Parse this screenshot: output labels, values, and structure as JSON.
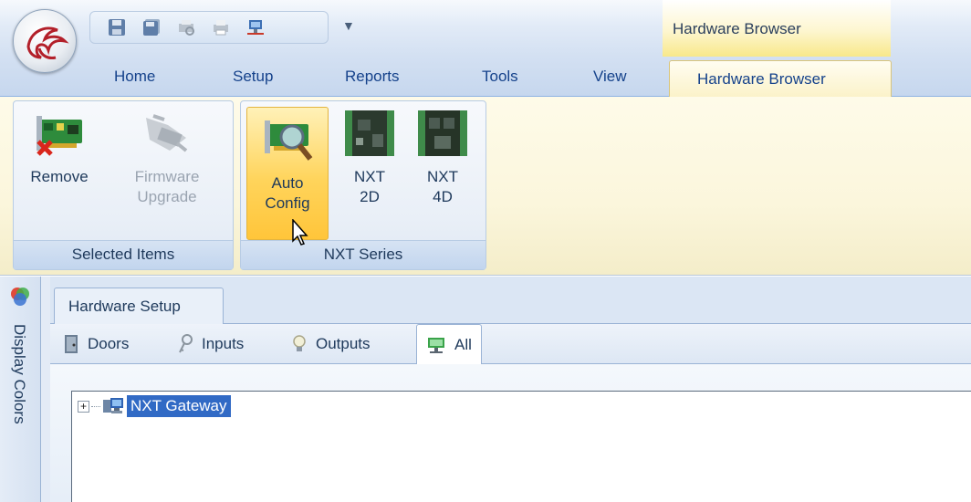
{
  "titlebar": {
    "context_label": "Hardware Browser",
    "qat_more": "▼"
  },
  "tabs": [
    "Home",
    "Setup",
    "Reports",
    "Tools",
    "View"
  ],
  "active_tab": "Hardware Browser",
  "ribbon": {
    "selected_items": {
      "label": "Selected Items",
      "remove": [
        "Remove"
      ],
      "firmware": [
        "Firmware",
        "Upgrade"
      ]
    },
    "nxt_series": {
      "label": "NXT Series",
      "auto_config": [
        "Auto",
        "Config"
      ],
      "nxt_2d": [
        "NXT",
        "2D"
      ],
      "nxt_4d": [
        "NXT",
        "4D"
      ]
    }
  },
  "sidepanel": {
    "label": "Display Colors"
  },
  "main": {
    "tab_setup": "Hardware Setup",
    "subtabs": {
      "doors": "Doors",
      "inputs": "Inputs",
      "outputs": "Outputs",
      "all": "All"
    },
    "tree": {
      "expander": "+",
      "node": "NXT Gateway"
    }
  },
  "colors": {
    "accent": "#15428b",
    "context_tab": "#fbf2c8",
    "selection": "#316ac5"
  }
}
